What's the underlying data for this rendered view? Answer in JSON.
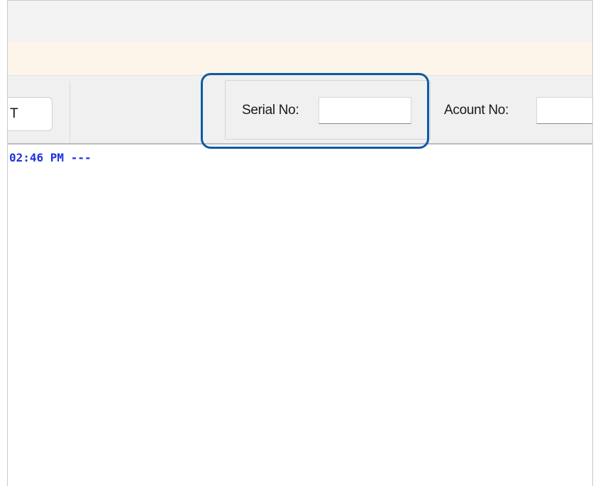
{
  "toolbar": {
    "mode_button_label": "T",
    "serial": {
      "label": "Serial No:",
      "value": "",
      "placeholder": ""
    },
    "account": {
      "label": "Acount No:",
      "value": "",
      "placeholder": ""
    }
  },
  "log": {
    "lines": [
      "02:46 PM ---"
    ]
  },
  "colors": {
    "highlight": "#0e5aa7",
    "log_text": "#1f31e0",
    "notice_bg": "#fdf5e9",
    "toolbar_bg": "#f0f0f0"
  }
}
